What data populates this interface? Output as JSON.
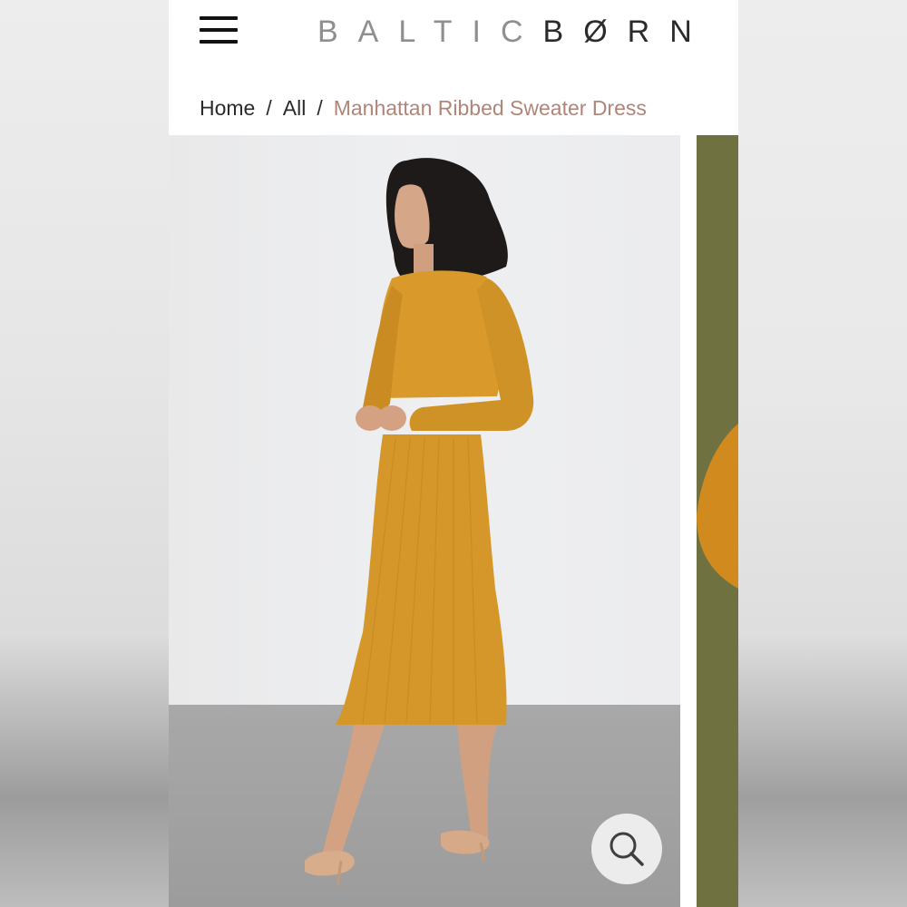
{
  "header": {
    "logo_light": "BALTIC",
    "logo_dark": "BØRN",
    "menu_icon": "hamburger-menu-icon"
  },
  "breadcrumb": {
    "items": [
      "Home",
      "All"
    ],
    "separator": "/",
    "current": "Manhattan Ribbed Sweater Dress"
  },
  "gallery": {
    "zoom_icon": "magnifier-icon"
  },
  "colors": {
    "breadcrumb_current": "#b08579",
    "dress": "#d99a2b",
    "next_photo_bg": "#6f7140"
  }
}
